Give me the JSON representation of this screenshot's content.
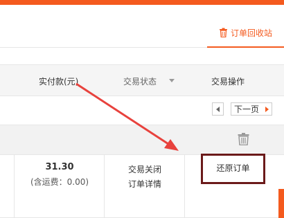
{
  "nav": {
    "recycle_bin_label": "订单回收站",
    "recycle_icon": "trash-icon"
  },
  "table_header": {
    "paid_amount": "实付款(元)",
    "trade_status": "交易状态",
    "trade_actions": "交易操作"
  },
  "pagination": {
    "next_label": "下一页"
  },
  "order": {
    "amount": "31.30",
    "shipping_note": "(含运费：0.00)",
    "status": "交易关闭",
    "detail_link": "订单详情",
    "restore_action": "还原订单",
    "delete_icon": "trash-icon"
  },
  "colors": {
    "accent": "#f45a1e",
    "highlight_box": "#6b1a1a",
    "annotation_arrow": "#e8423d"
  }
}
